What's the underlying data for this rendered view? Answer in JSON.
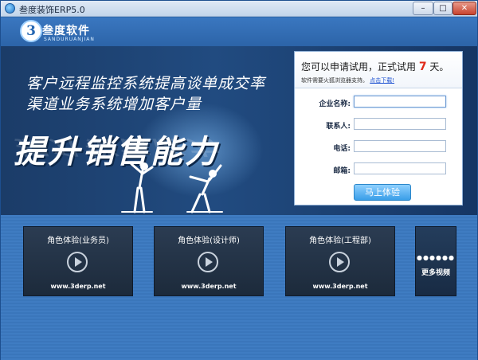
{
  "window": {
    "title": "叁度装饰ERP5.0",
    "min_label": "–",
    "max_label": "□",
    "close_label": "✕"
  },
  "logo": {
    "mark": "3",
    "name": "叁度软件",
    "sub": "SANDURUANJIAN"
  },
  "banner": {
    "slogan_line1": "客户远程监控系统提高谈单成交率",
    "slogan_line2": "渠道业务系统增加客户量",
    "big_slogan": "提升销售能力"
  },
  "trial_form": {
    "heading_prefix": "您可以申请试用，正式试用",
    "days": "7",
    "heading_suffix": "天。",
    "note_text": "软件需要火狐浏览器支持。",
    "note_link": "点击下载!",
    "fields": [
      {
        "label": "企业名称:",
        "value": ""
      },
      {
        "label": "联系人:",
        "value": ""
      },
      {
        "label": "电话:",
        "value": ""
      },
      {
        "label": "邮箱:",
        "value": ""
      }
    ],
    "submit_label": "马上体验"
  },
  "videos": [
    {
      "title": "角色体验(业务员)",
      "url": "www.3derp.net"
    },
    {
      "title": "角色体验(设计师)",
      "url": "www.3derp.net"
    },
    {
      "title": "角色体验(工程部)",
      "url": "www.3derp.net"
    }
  ],
  "more": {
    "dots": "●●●●●●",
    "label": "更多视频"
  },
  "colors": {
    "accent": "#3a9ee8",
    "days_color": "#e02a1a",
    "link_color": "#1a4fd0",
    "banner_bg": "#1b3c68"
  }
}
